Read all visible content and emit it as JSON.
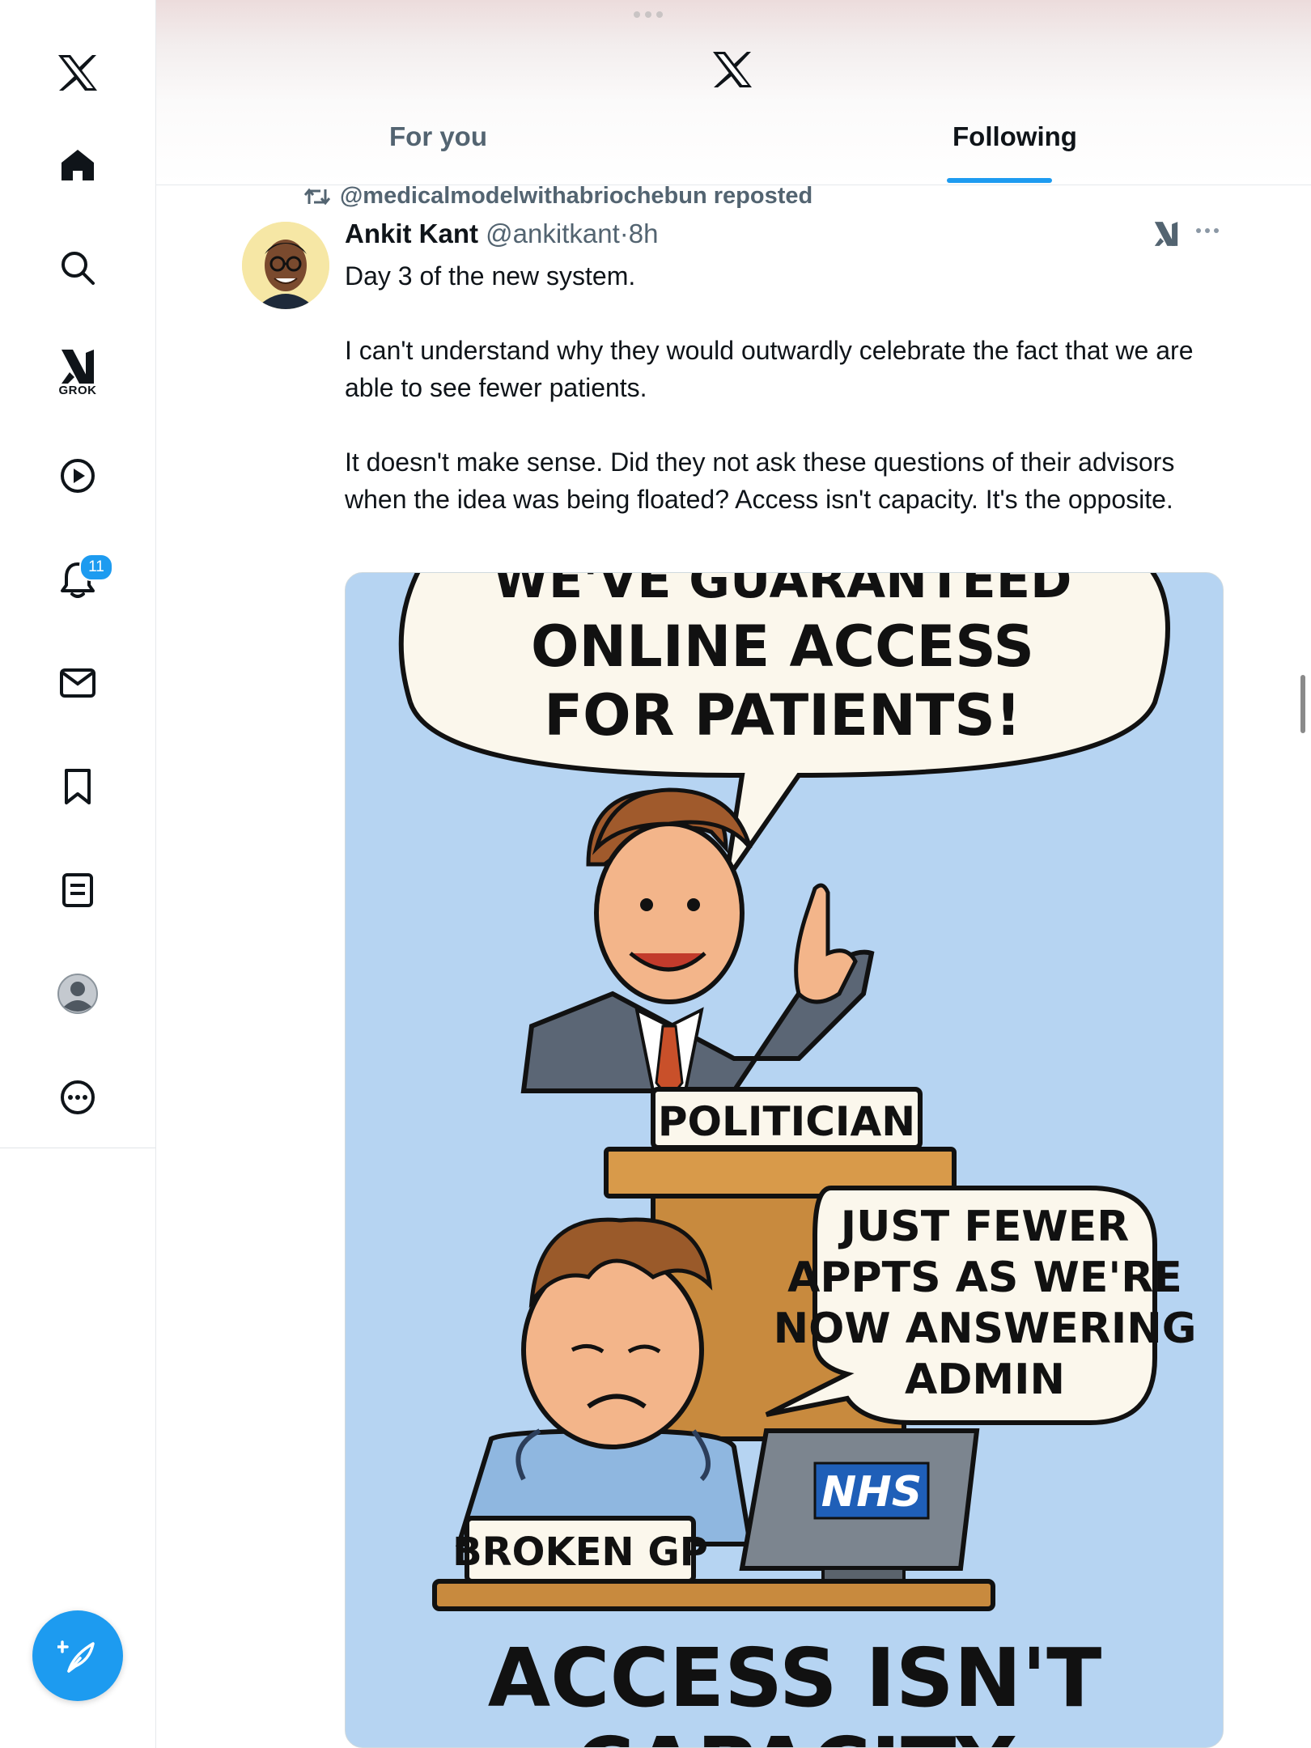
{
  "nav": {
    "grok_label": "GROK",
    "notification_count": "11"
  },
  "header": {
    "tabs": [
      "For you",
      "Following"
    ],
    "active_tab": "Following"
  },
  "post": {
    "repost_text": "@medicalmodelwithabriochebun reposted",
    "author_name": "Ankit Kant",
    "author_handle": "@ankitkant",
    "separator": "·",
    "time": "8h",
    "paragraphs": [
      "Day 3 of the new system.",
      "I can't understand why they would outwardly celebrate the fact that we are able to see fewer patients.",
      "It doesn't make sense. Did they not ask these questions of their advisors when the idea was being floated? Access isn't capacity. It's the opposite."
    ],
    "image": {
      "bubble_top_lines": [
        "WE'VE GUARANTEED",
        "ONLINE ACCESS",
        "FOR PATIENTS!"
      ],
      "politician_label": "POLITICIAN",
      "bubble_gp_lines": [
        "JUST FEWER",
        "APPTS AS WE'RE",
        "NOW ANSWERING",
        "ADMIN"
      ],
      "monitor_label": "NHS",
      "gp_label": "BROKEN GP",
      "caption_lines": [
        "ACCESS ISN'T",
        "CAPACITY"
      ]
    }
  },
  "colors": {
    "accent": "#1d9bf0",
    "muted_text": "#536471",
    "image_background": "#b6d4f2",
    "nhs_blue": "#1f5fb8"
  }
}
